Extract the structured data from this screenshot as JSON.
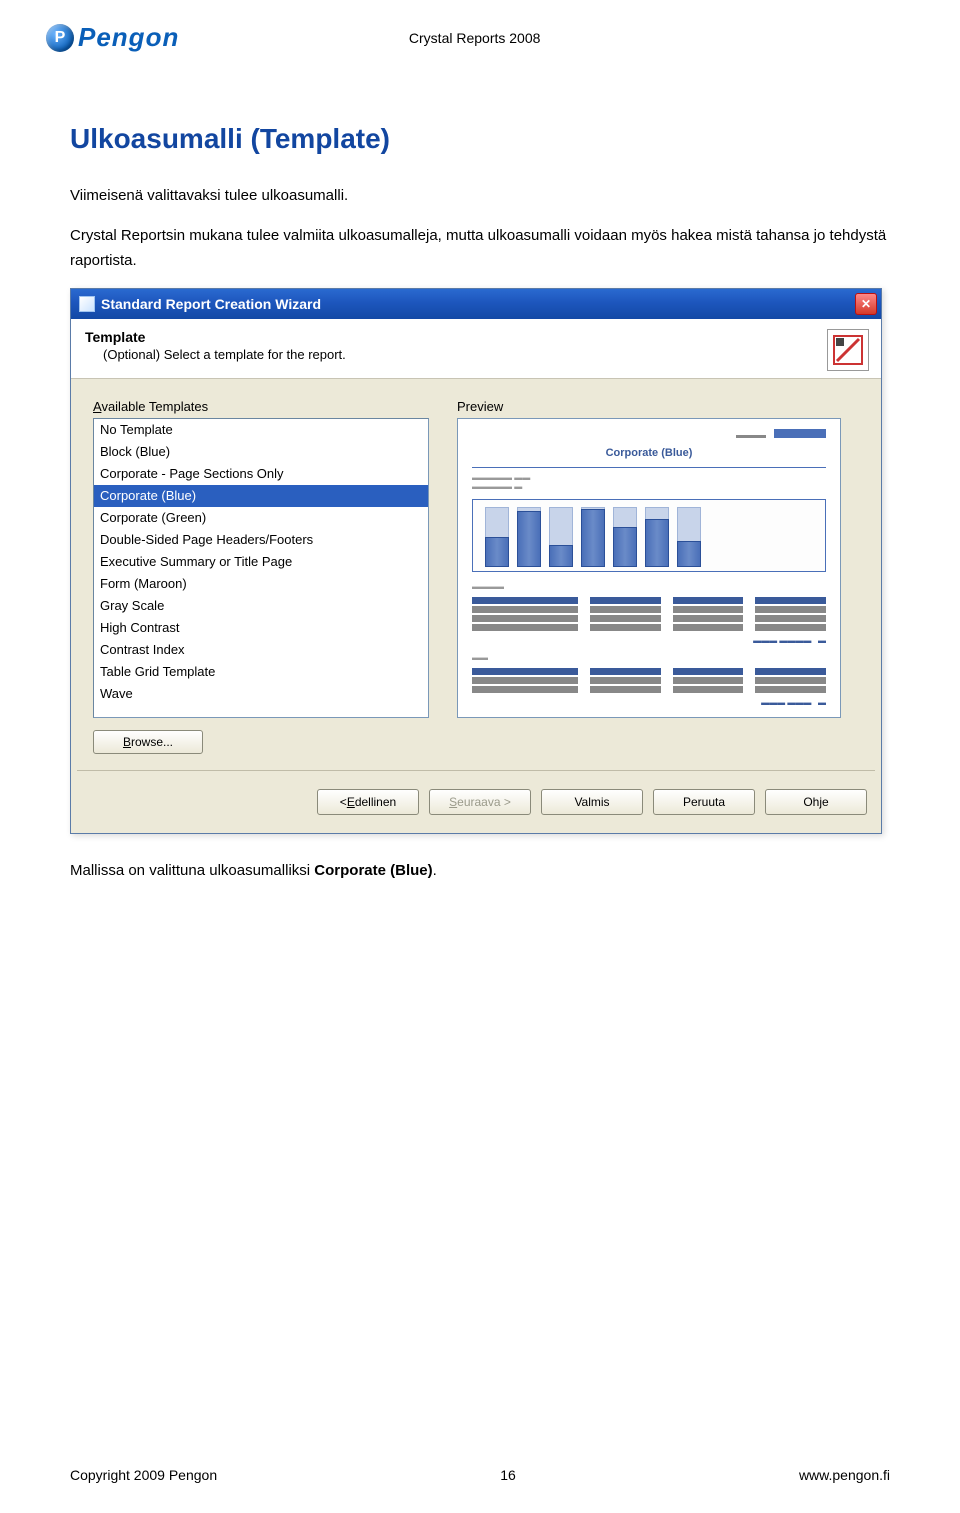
{
  "header": {
    "logo_letter": "P",
    "logo_text": "Pengon",
    "doc_title": "Crystal Reports 2008"
  },
  "section": {
    "title": "Ulkoasumalli (Template)",
    "para1": "Viimeisenä valittavaksi tulee ulkoasumalli.",
    "para2": "Crystal Reportsin mukana tulee valmiita ulkoasumalleja, mutta ulkoasumalli voidaan myös hakea mistä tahansa jo tehdystä raportista."
  },
  "dialog": {
    "title": "Standard Report Creation Wizard",
    "close": "✕",
    "header_title": "Template",
    "header_sub": "(Optional) Select a template for the report.",
    "available_label": "Available Templates",
    "preview_label": "Preview",
    "templates": [
      "No Template",
      "Block (Blue)",
      "Corporate - Page Sections Only",
      "Corporate (Blue)",
      "Corporate (Green)",
      "Double-Sided Page Headers/Footers",
      "Executive Summary or Title Page",
      "Form (Maroon)",
      "Gray Scale",
      "High Contrast",
      "Contrast Index",
      "Table Grid Template",
      "Wave"
    ],
    "selected_index": 3,
    "preview_title": "Corporate (Blue)",
    "browse": "Browse...",
    "buttons": {
      "back": "< Edellinen",
      "next": "Seuraava >",
      "finish": "Valmis",
      "cancel": "Peruuta",
      "help": "Ohje"
    }
  },
  "caption": {
    "prefix": "Mallissa on valittuna ulkoasumalliksi ",
    "bold": "Corporate (Blue)",
    "suffix": "."
  },
  "footer": {
    "left": "Copyright 2009 Pengon",
    "center": "16",
    "right": "www.pengon.fi"
  }
}
